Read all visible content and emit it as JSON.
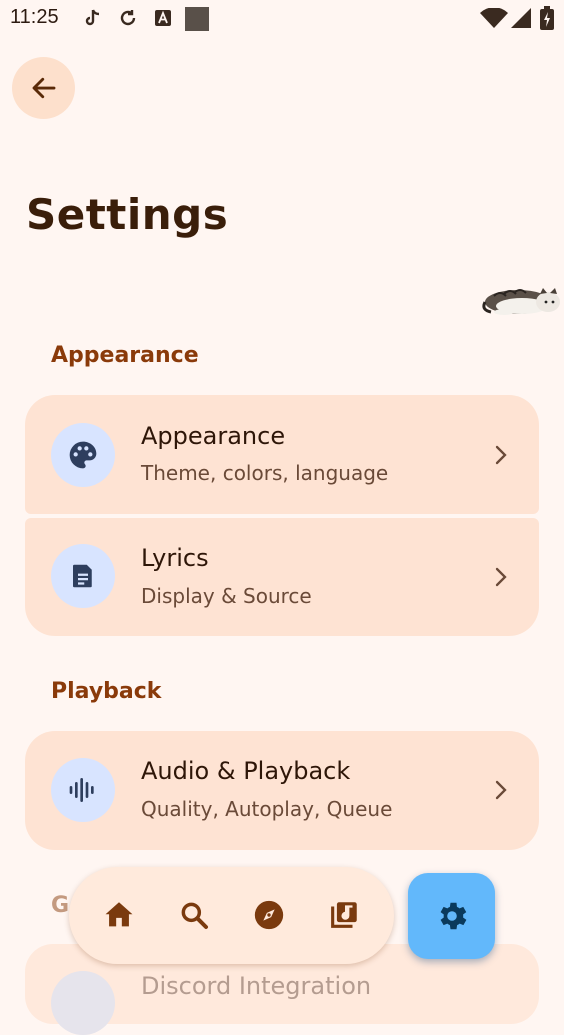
{
  "status_bar": {
    "time": "11:25"
  },
  "page": {
    "title": "Settings"
  },
  "sections": {
    "appearance": {
      "header": "Appearance",
      "items": [
        {
          "title": "Appearance",
          "subtitle": "Theme, colors, language",
          "icon": "palette-icon"
        },
        {
          "title": "Lyrics",
          "subtitle": "Display & Source",
          "icon": "document-icon"
        }
      ]
    },
    "playback": {
      "header": "Playback",
      "items": [
        {
          "title": "Audio & Playback",
          "subtitle": "Quality, Autoplay, Queue",
          "icon": "audio-wave-icon"
        }
      ]
    },
    "general": {
      "header_partial": "G",
      "items": [
        {
          "title": "Discord Integration",
          "icon": "discord-icon"
        }
      ]
    }
  },
  "nav": {
    "items": [
      "home-icon",
      "search-icon",
      "explore-icon",
      "library-icon"
    ],
    "active": "settings-icon"
  },
  "colors": {
    "background": "#FFF6F2",
    "card": "#FEE3D3",
    "section_header": "#8A3A0A",
    "fab": "#62B8FB",
    "icon_circle": "#D8E4FF"
  }
}
